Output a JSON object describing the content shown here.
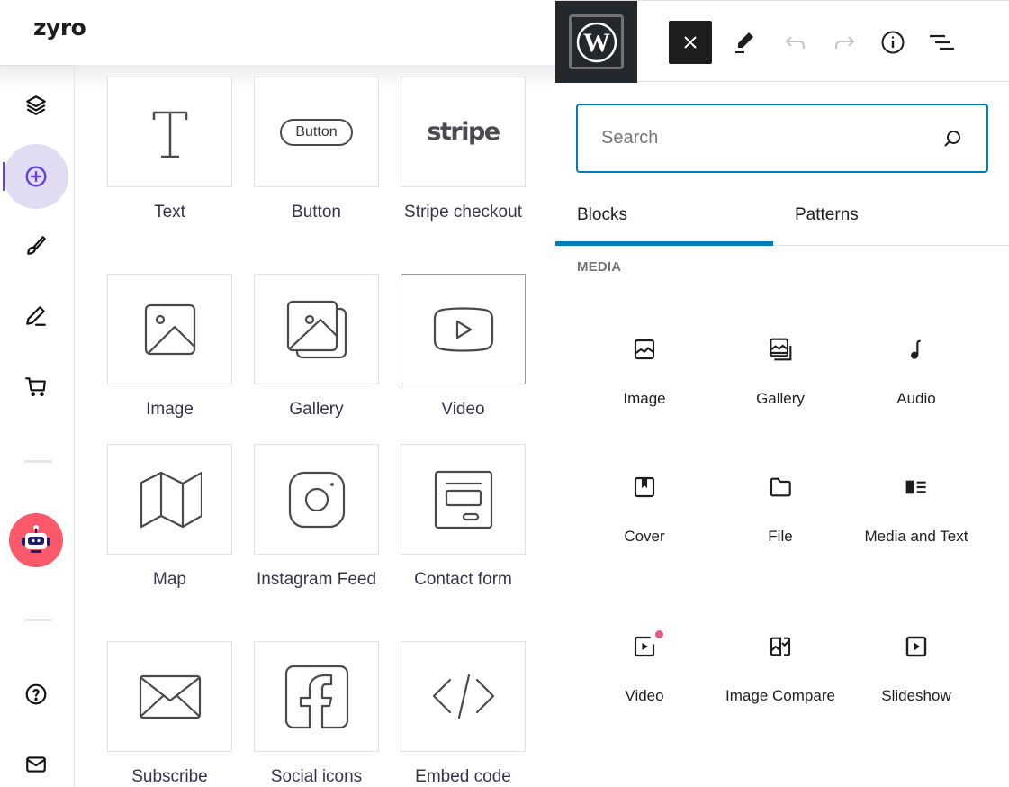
{
  "zyro": {
    "logo": "zyro",
    "sidebar": [
      {
        "name": "layers",
        "icon": "layers-icon",
        "active": false
      },
      {
        "name": "add-element",
        "icon": "plus-circle-icon",
        "active": true
      },
      {
        "name": "design",
        "icon": "brush-icon",
        "active": false
      },
      {
        "name": "edit",
        "icon": "pen-icon",
        "active": false
      },
      {
        "name": "store",
        "icon": "cart-icon",
        "active": false
      },
      {
        "name": "ai-assistant",
        "icon": "robot-icon",
        "active": false
      },
      {
        "name": "help",
        "icon": "question-circle-icon",
        "active": false
      },
      {
        "name": "messages",
        "icon": "mail-icon",
        "active": false
      }
    ],
    "elements": [
      {
        "label": "Text",
        "icon": "text-icon"
      },
      {
        "label": "Button",
        "icon": "button-icon",
        "preview": "Button"
      },
      {
        "label": "Stripe checkout",
        "icon": "stripe-icon",
        "preview": "stripe"
      },
      {
        "label": "Image",
        "icon": "image-icon"
      },
      {
        "label": "Gallery",
        "icon": "gallery-icon"
      },
      {
        "label": "Video",
        "icon": "video-icon"
      },
      {
        "label": "Map",
        "icon": "map-icon"
      },
      {
        "label": "Instagram Feed",
        "icon": "instagram-icon"
      },
      {
        "label": "Contact form",
        "icon": "contact-form-icon"
      },
      {
        "label": "Subscribe",
        "icon": "envelope-icon"
      },
      {
        "label": "Social icons",
        "icon": "facebook-icon"
      },
      {
        "label": "Embed code",
        "icon": "code-icon"
      }
    ]
  },
  "wp": {
    "toolbar": {
      "logo": "wordpress-logo",
      "close": "Close block inserter",
      "tools": "Tools",
      "undo": "Undo",
      "redo": "Redo",
      "details": "Details",
      "outline": "Document overview"
    },
    "search": {
      "placeholder": "Search",
      "value": ""
    },
    "tabs": [
      {
        "label": "Blocks",
        "active": true
      },
      {
        "label": "Patterns",
        "active": false
      }
    ],
    "section": "MEDIA",
    "blocks": [
      {
        "label": "Image",
        "icon": "image-icon"
      },
      {
        "label": "Gallery",
        "icon": "gallery-icon"
      },
      {
        "label": "Audio",
        "icon": "audio-icon"
      },
      {
        "label": "Cover",
        "icon": "cover-icon"
      },
      {
        "label": "File",
        "icon": "folder-icon"
      },
      {
        "label": "Media and Text",
        "icon": "media-text-icon"
      },
      {
        "label": "Video",
        "icon": "video-icon",
        "badge": true
      },
      {
        "label": "Image Compare",
        "icon": "image-compare-icon"
      },
      {
        "label": "Slideshow",
        "icon": "slideshow-icon"
      }
    ],
    "colors": {
      "accent": "#007cba",
      "badge": "#e65a84",
      "dark": "#1e1e1e"
    }
  }
}
